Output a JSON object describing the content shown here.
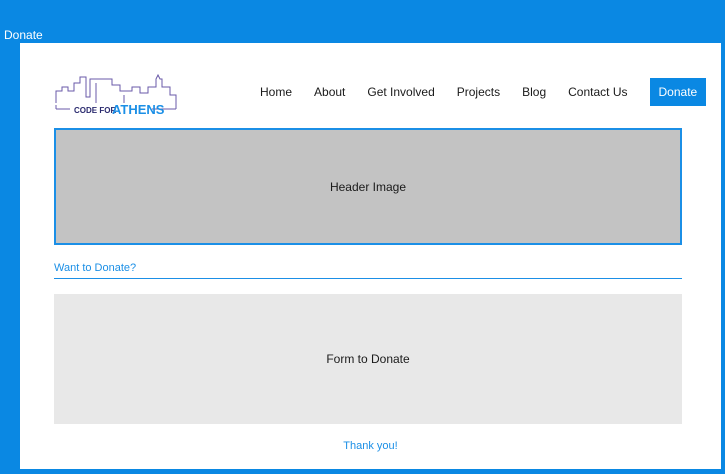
{
  "frame": {
    "title": "Donate"
  },
  "logo": {
    "text_prefix": "CODE FOR",
    "text_name": "ATHENS",
    "colors": {
      "outline": "#6a5aa8",
      "prefix": "#2a2a6e",
      "name": "#1b8fe6"
    }
  },
  "nav": {
    "items": [
      {
        "label": "Home"
      },
      {
        "label": "About"
      },
      {
        "label": "Get Involved"
      },
      {
        "label": "Projects"
      },
      {
        "label": "Blog"
      },
      {
        "label": "Contact Us"
      }
    ],
    "donate_label": "Donate"
  },
  "header_image": {
    "label": "Header Image"
  },
  "donate_section": {
    "title": "Want to Donate?",
    "form_label": "Form to Donate",
    "thanks": "Thank you!"
  },
  "colors": {
    "accent": "#0a88e3",
    "placeholder_dark": "#c3c3c3",
    "placeholder_light": "#e8e8e8"
  }
}
